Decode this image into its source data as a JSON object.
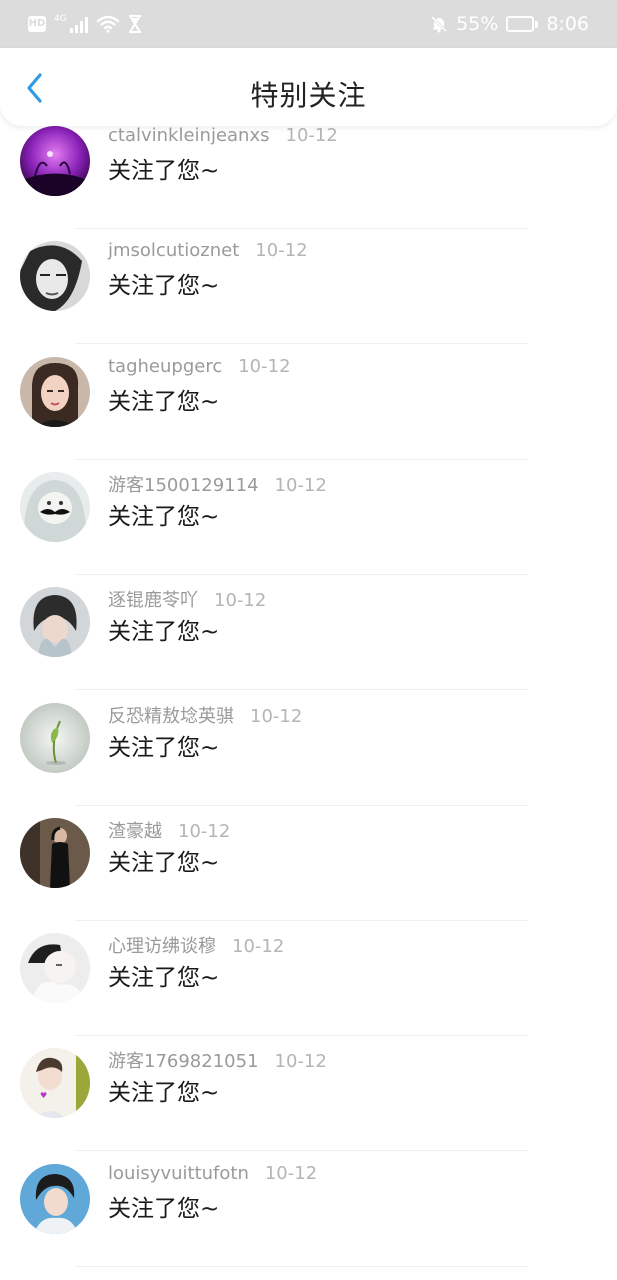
{
  "status_bar": {
    "network": "4G",
    "battery": "55%",
    "time": "8:06",
    "battery_level": 0.55
  },
  "nav": {
    "title": "特别关注",
    "back_icon": "chevron-left-icon",
    "accent": "#2f9be8"
  },
  "items": [
    {
      "name": "ctalvinkleinjeanxs",
      "date": "10-12",
      "message": "关注了您~"
    },
    {
      "name": "jmsolcutioznet",
      "date": "10-12",
      "message": "关注了您~"
    },
    {
      "name": "tagheupgerc",
      "date": "10-12",
      "message": "关注了您~"
    },
    {
      "name": "游客1500129114",
      "date": "10-12",
      "message": "关注了您~"
    },
    {
      "name": "逐锟鹿苓吖",
      "date": "10-12",
      "message": "关注了您~"
    },
    {
      "name": "反恐精敖埝英骐",
      "date": "10-12",
      "message": "关注了您~"
    },
    {
      "name": "渣豪越",
      "date": "10-12",
      "message": "关注了您~"
    },
    {
      "name": "心理访绋谈穆",
      "date": "10-12",
      "message": "关注了您~"
    },
    {
      "name": "游客1769821051",
      "date": "10-12",
      "message": "关注了您~"
    },
    {
      "name": "louisyvuittufotn",
      "date": "10-12",
      "message": "关注了您~"
    }
  ]
}
